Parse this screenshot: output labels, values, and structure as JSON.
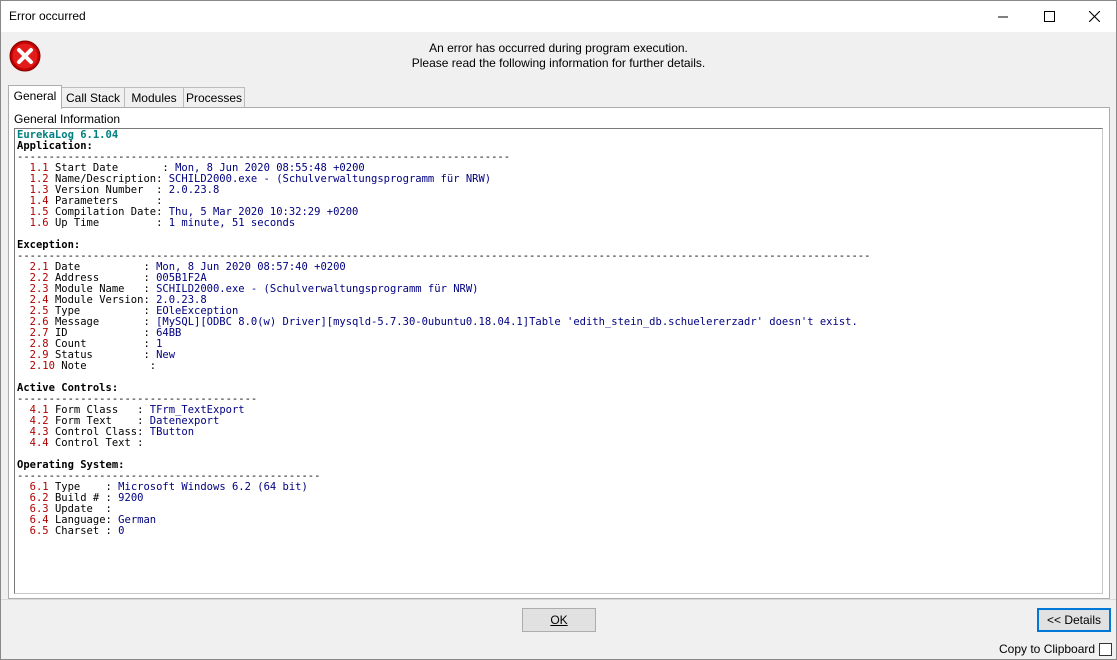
{
  "window": {
    "title": "Error occurred",
    "minimize_icon": "minimize-icon",
    "maximize_icon": "maximize-icon",
    "close_icon": "close-icon"
  },
  "header": {
    "icon": "error-icon",
    "line1": "An error has occurred during program execution.",
    "line2": "Please read the following information for further details."
  },
  "tabs": [
    {
      "label": "General"
    },
    {
      "label": "Call Stack"
    },
    {
      "label": "Modules"
    },
    {
      "label": "Processes"
    }
  ],
  "panel": {
    "label": "General Information",
    "log_title": "EurekaLog 6.1.04",
    "sections": [
      {
        "heading": "Application:",
        "rule": "------------------------------------------------------------------------------",
        "rows": [
          {
            "num": "1.1",
            "key": " Start Date       : ",
            "val": "Mon, 8 Jun 2020 08:55:48 +0200"
          },
          {
            "num": "1.2",
            "key": " Name/Description: ",
            "val": "SCHILD2000.exe - (Schulverwaltungsprogramm für NRW)"
          },
          {
            "num": "1.3",
            "key": " Version Number  : ",
            "val": "2.0.23.8"
          },
          {
            "num": "1.4",
            "key": " Parameters      : ",
            "val": ""
          },
          {
            "num": "1.5",
            "key": " Compilation Date: ",
            "val": "Thu, 5 Mar 2020 10:32:29 +0200"
          },
          {
            "num": "1.6",
            "key": " Up Time         : ",
            "val": "1 minute, 51 seconds"
          }
        ]
      },
      {
        "heading": "Exception:",
        "rule": "---------------------------------------------------------------------------------------------------------------------------------------",
        "rows": [
          {
            "num": "2.1",
            "key": " Date          : ",
            "val": "Mon, 8 Jun 2020 08:57:40 +0200"
          },
          {
            "num": "2.2",
            "key": " Address       : ",
            "val": "005B1F2A"
          },
          {
            "num": "2.3",
            "key": " Module Name   : ",
            "val": "SCHILD2000.exe - (Schulverwaltungsprogramm für NRW)"
          },
          {
            "num": "2.4",
            "key": " Module Version: ",
            "val": "2.0.23.8"
          },
          {
            "num": "2.5",
            "key": " Type          : ",
            "val": "EOleException"
          },
          {
            "num": "2.6",
            "key": " Message       : ",
            "val": "[MySQL][ODBC 8.0(w) Driver][mysqld-5.7.30-0ubuntu0.18.04.1]Table 'edith_stein_db.schuelererzadr' doesn't exist."
          },
          {
            "num": "2.7",
            "key": " ID            : ",
            "val": "64BB"
          },
          {
            "num": "2.8",
            "key": " Count         : ",
            "val": "1"
          },
          {
            "num": "2.9",
            "key": " Status        : ",
            "val": "New"
          },
          {
            "num": "2.10",
            "key": " Note          : ",
            "val": ""
          }
        ]
      },
      {
        "heading": "Active Controls:",
        "rule": "--------------------------------------",
        "rows": [
          {
            "num": "4.1",
            "key": " Form Class   : ",
            "val": "TFrm_TextExport"
          },
          {
            "num": "4.2",
            "key": " Form Text    : ",
            "val": "Datenexport"
          },
          {
            "num": "4.3",
            "key": " Control Class: ",
            "val": "TButton"
          },
          {
            "num": "4.4",
            "key": " Control Text : ",
            "val": ""
          }
        ]
      },
      {
        "heading": "Operating System:",
        "rule": "------------------------------------------------",
        "rows": [
          {
            "num": "6.1",
            "key": " Type    : ",
            "val": "Microsoft Windows 6.2 (64 bit)"
          },
          {
            "num": "6.2",
            "key": " Build # : ",
            "val": "9200"
          },
          {
            "num": "6.3",
            "key": " Update  : ",
            "val": ""
          },
          {
            "num": "6.4",
            "key": " Language: ",
            "val": "German"
          },
          {
            "num": "6.5",
            "key": " Charset : ",
            "val": "0"
          }
        ]
      }
    ]
  },
  "footer": {
    "ok_label": "OK",
    "details_label": "<< Details",
    "clipboard_label": "Copy to Clipboard"
  }
}
